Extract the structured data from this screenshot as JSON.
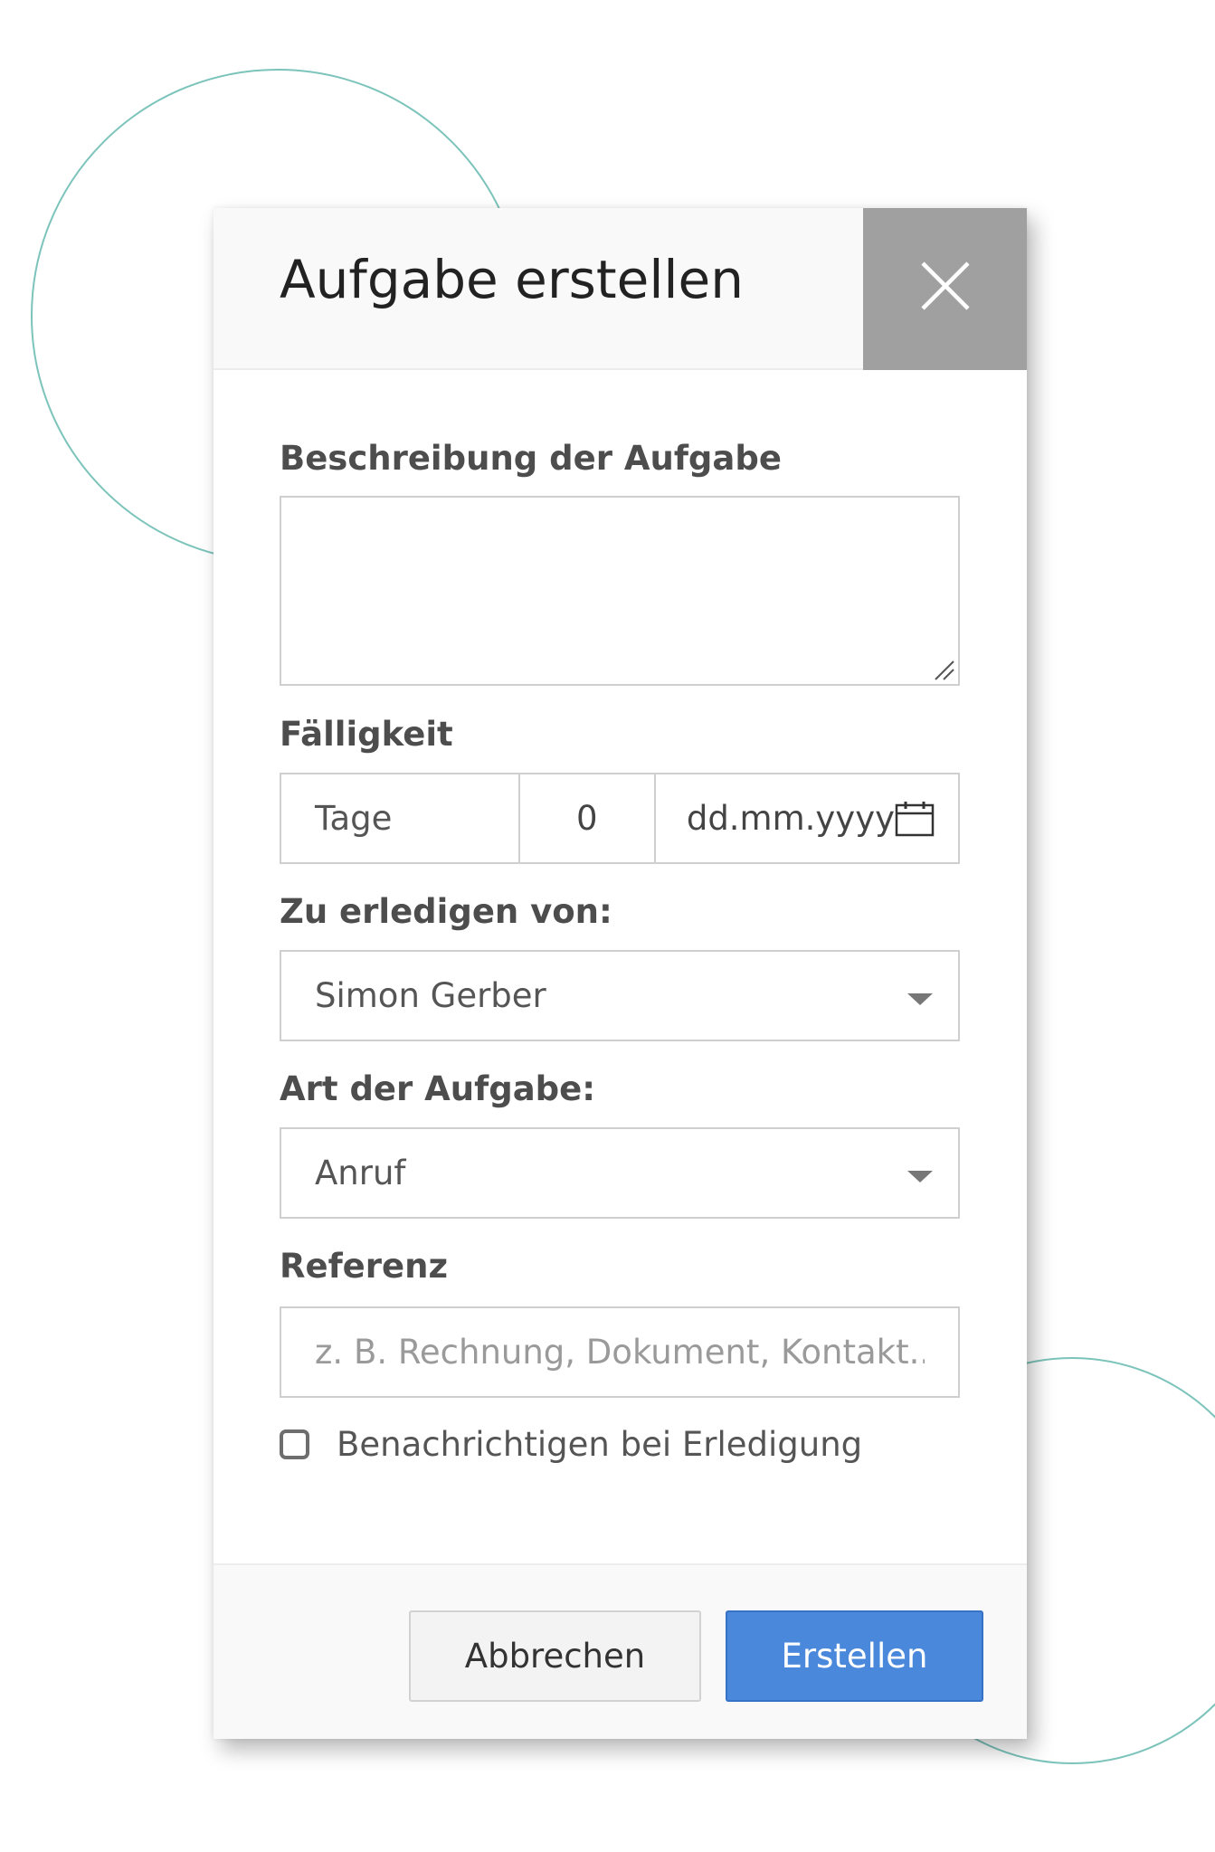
{
  "dialog": {
    "title": "Aufgabe erstellen"
  },
  "description": {
    "label": "Beschreibung der Aufgabe",
    "value": ""
  },
  "due": {
    "label": "Fälligkeit",
    "unit": "Tage",
    "count": "0",
    "date_placeholder": "dd.mm.yyyy"
  },
  "assignee": {
    "label": "Zu erledigen von:",
    "selected": "Simon Gerber"
  },
  "task_type": {
    "label": "Art der Aufgabe:",
    "selected": "Anruf"
  },
  "reference": {
    "label": "Referenz",
    "placeholder": "z. B. Rechnung, Dokument, Kontakt..."
  },
  "notify": {
    "label": "Benachrichtigen bei Erledigung",
    "checked": false
  },
  "footer": {
    "cancel_label": "Abbrechen",
    "create_label": "Erstellen"
  },
  "colors": {
    "accent": "#4a88dc",
    "decoration": "#7cc4bb",
    "close_bg": "#a0a0a0"
  }
}
